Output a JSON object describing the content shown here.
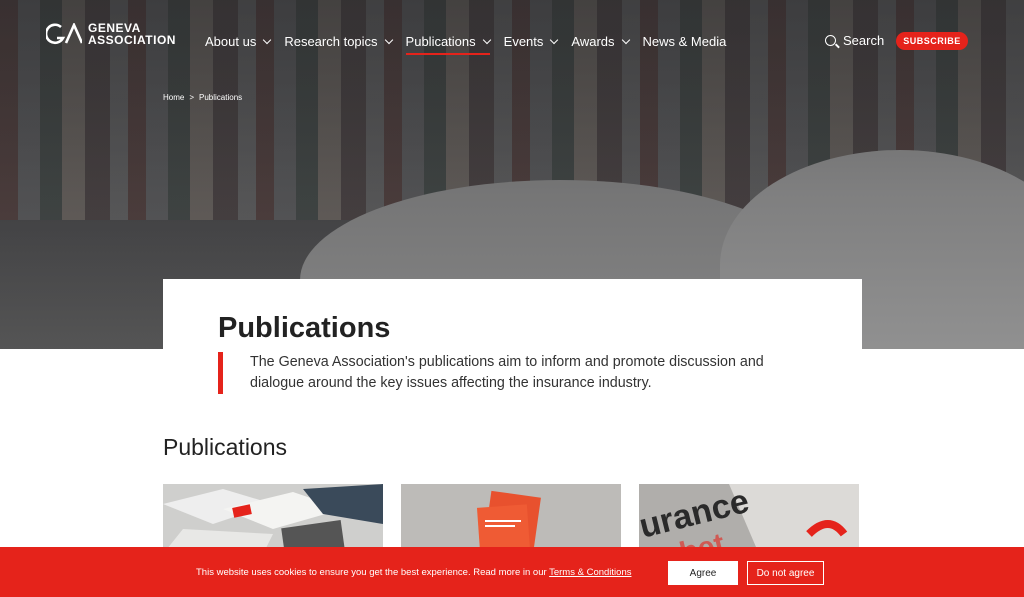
{
  "brand": {
    "line1": "GENEVA",
    "line2": "ASSOCIATION"
  },
  "nav": {
    "items": [
      {
        "label": "About us",
        "has_dropdown": true,
        "active": false
      },
      {
        "label": "Research topics",
        "has_dropdown": true,
        "active": false
      },
      {
        "label": "Publications",
        "has_dropdown": true,
        "active": true
      },
      {
        "label": "Events",
        "has_dropdown": true,
        "active": false
      },
      {
        "label": "Awards",
        "has_dropdown": true,
        "active": false
      },
      {
        "label": "News & Media",
        "has_dropdown": false,
        "active": false
      }
    ],
    "search_label": "Search",
    "subscribe_label": "SUBSCRIBE"
  },
  "breadcrumb": {
    "home": "Home",
    "separator": ">",
    "current": "Publications"
  },
  "page": {
    "title": "Publications",
    "intro": "The Geneva Association's publications aim to inform and promote discussion and dialogue around the key issues affecting the insurance industry.",
    "section_title": "Publications"
  },
  "cookie": {
    "text": "This website uses cookies to ensure you get the best experience. Read more in our ",
    "link": "Terms & Conditions",
    "agree": "Agree",
    "disagree": "Do not agree"
  },
  "colors": {
    "accent": "#e5231b",
    "text": "#222222"
  }
}
